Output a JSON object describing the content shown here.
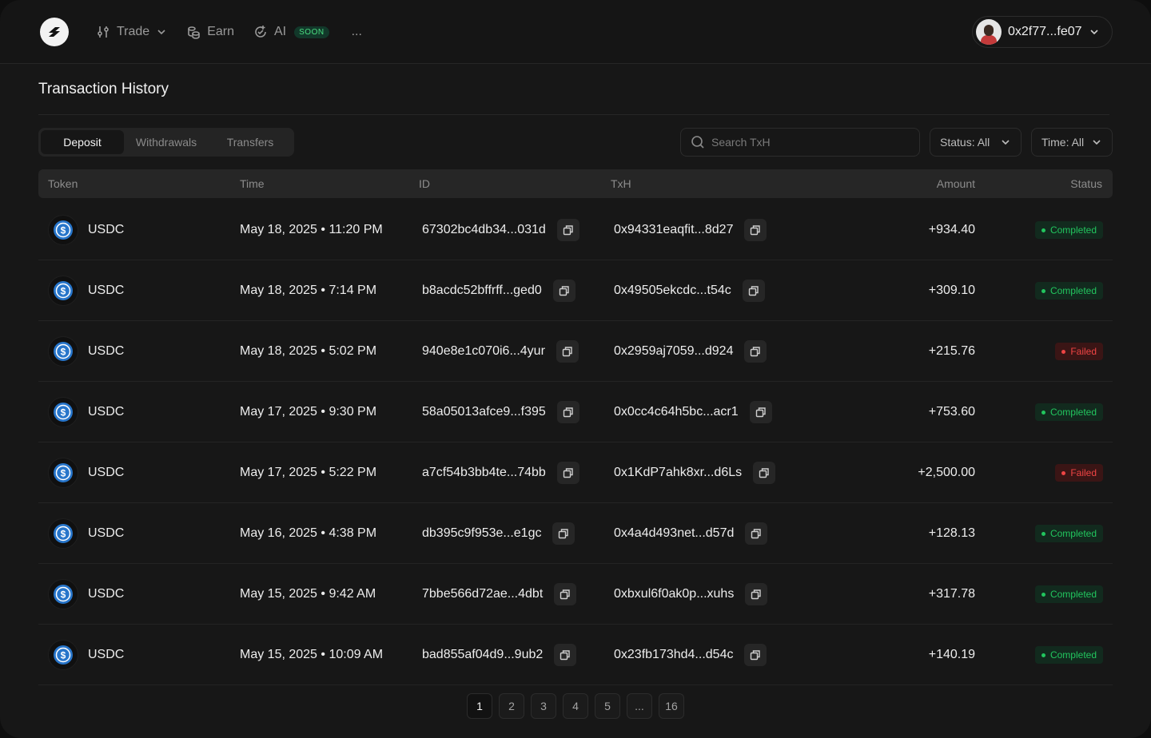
{
  "header": {
    "nav": [
      {
        "label": "Trade",
        "icon": "sliders-icon",
        "dropdown": true
      },
      {
        "label": "Earn",
        "icon": "coins-icon",
        "dropdown": false
      },
      {
        "label": "AI",
        "icon": "ai-sparkle-icon",
        "badge": "SOON",
        "dropdown": false
      }
    ],
    "more": "...",
    "wallet_address": "0x2f77...fe07"
  },
  "page_title": "Transaction History",
  "tabs": [
    "Deposit",
    "Withdrawals",
    "Transfers"
  ],
  "active_tab": "Deposit",
  "search": {
    "placeholder": "Search TxH",
    "value": ""
  },
  "filters": {
    "status": "Status: All",
    "time": "Time: All"
  },
  "columns": [
    "Token",
    "Time",
    "ID",
    "TxH",
    "Amount",
    "Status"
  ],
  "rows": [
    {
      "token": "USDC",
      "time": "May 18, 2025 • 11:20 PM",
      "id": "67302bc4db34...031d",
      "txh": "0x94331eaqfit...8d27",
      "amount": "+934.40",
      "status": "Completed"
    },
    {
      "token": "USDC",
      "time": "May 18, 2025 • 7:14 PM",
      "id": "b8acdc52bffrff...ged0",
      "txh": "0x49505ekcdc...t54c",
      "amount": "+309.10",
      "status": "Completed"
    },
    {
      "token": "USDC",
      "time": "May 18, 2025 • 5:02 PM",
      "id": "940e8e1c070i6...4yur",
      "txh": "0x2959aj7059...d924",
      "amount": "+215.76",
      "status": "Failed"
    },
    {
      "token": "USDC",
      "time": "May 17, 2025 • 9:30 PM",
      "id": "58a05013afce9...f395",
      "txh": "0x0cc4c64h5bc...acr1",
      "amount": "+753.60",
      "status": "Completed"
    },
    {
      "token": "USDC",
      "time": "May 17, 2025 • 5:22 PM",
      "id": "a7cf54b3bb4te...74bb",
      "txh": "0x1KdP7ahk8xr...d6Ls",
      "amount": "+2,500.00",
      "status": "Failed"
    },
    {
      "token": "USDC",
      "time": "May 16, 2025 • 4:38 PM",
      "id": "db395c9f953e...e1gc",
      "txh": "0x4a4d493net...d57d",
      "amount": "+128.13",
      "status": "Completed"
    },
    {
      "token": "USDC",
      "time": "May 15, 2025 • 9:42 AM",
      "id": "7bbe566d72ae...4dbt",
      "txh": "0xbxul6f0ak0p...xuhs",
      "amount": "+317.78",
      "status": "Completed"
    },
    {
      "token": "USDC",
      "time": "May 15, 2025 • 10:09 AM",
      "id": "bad855af04d9...9ub2",
      "txh": "0x23fb173hd4...d54c",
      "amount": "+140.19",
      "status": "Completed"
    }
  ],
  "pagination": [
    "1",
    "2",
    "3",
    "4",
    "5",
    "...",
    "16"
  ],
  "current_page": "1",
  "colors": {
    "completed": "#22c55e",
    "failed": "#ef4444",
    "usdc": "#2775ca",
    "soon": "#4ade80"
  }
}
